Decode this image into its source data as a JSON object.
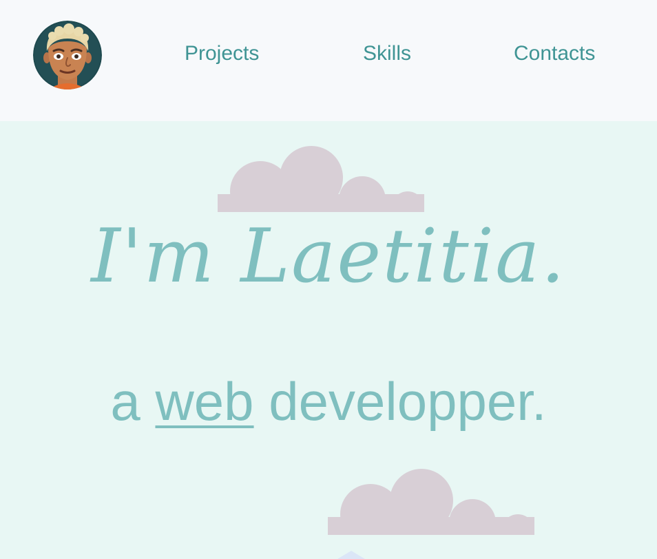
{
  "header": {
    "avatar_icon": "cartoon-avatar-icon",
    "nav": [
      {
        "label": "Projects"
      },
      {
        "label": "Skills"
      },
      {
        "label": "Contacts"
      }
    ],
    "nav_color": "#3f9494",
    "background": "#f7f9fb"
  },
  "hero": {
    "background": "#e8f7f4",
    "headline": "I'm Laetitia.",
    "subline": {
      "prefix": "a ",
      "link": "web",
      "suffix": " developper."
    },
    "text_color": "#7fbfbf",
    "cloud_color": "#d8cfd6",
    "decorations": [
      "cloud-icon",
      "cloud-icon"
    ]
  }
}
